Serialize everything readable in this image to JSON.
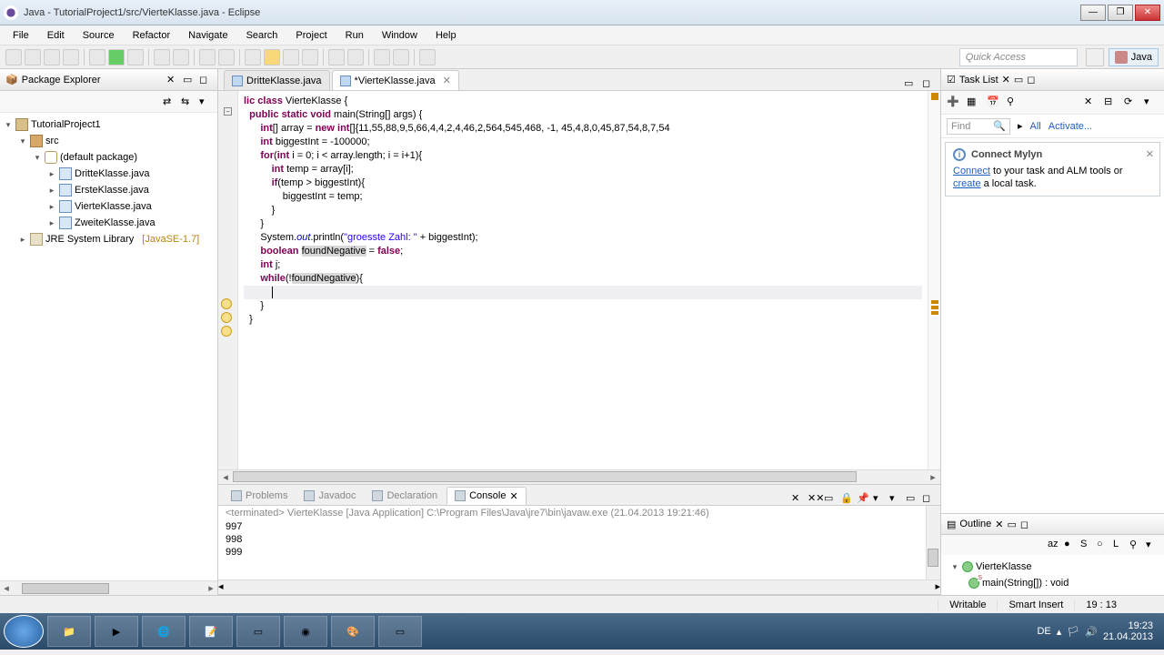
{
  "window": {
    "title": "Java - TutorialProject1/src/VierteKlasse.java - Eclipse"
  },
  "menu": [
    "File",
    "Edit",
    "Source",
    "Refactor",
    "Navigate",
    "Search",
    "Project",
    "Run",
    "Window",
    "Help"
  ],
  "quick_access": "Quick Access",
  "perspective": "Java",
  "package_explorer": {
    "title": "Package Explorer",
    "project": "TutorialProject1",
    "src": "src",
    "pkg": "(default package)",
    "files": [
      "DritteKlasse.java",
      "ErsteKlasse.java",
      "VierteKlasse.java",
      "ZweiteKlasse.java"
    ],
    "jre": "JRE System Library",
    "jre_suffix": "[JavaSE-1.7]"
  },
  "editor": {
    "tabs": [
      {
        "label": "DritteKlasse.java"
      },
      {
        "label": "*VierteKlasse.java"
      }
    ],
    "code": {
      "l1a": "lic class",
      "l1b": " VierteKlasse {",
      "l2a": "public static void",
      "l2b": " main(String[] args) {",
      "l3a": "int",
      "l3b": "[] array = ",
      "l3c": "new int",
      "l3d": "[]{11,55,88,9,5,66,4,4,2,4,46,2,564,545,468, -1, 45,4,8,0,45,87,54,8,7,54",
      "l4a": "int",
      "l4b": " biggestInt = -100000;",
      "l5a": "for",
      "l5b": "(",
      "l5c": "int",
      "l5d": " i = 0; i < array.length; i = i+1){",
      "l6a": "int",
      "l6b": " temp = array[i];",
      "l7": "",
      "l8a": "if",
      "l8b": "(temp > biggestInt){",
      "l9": "biggestInt = temp;",
      "l10": "}",
      "l11": "}",
      "l12": "",
      "l13a": "System.",
      "l13b": "out",
      "l13c": ".println(",
      "l13d": "\"groesste Zahl: \"",
      "l13e": " + biggestInt);",
      "l14": "",
      "l15a": "boolean",
      "l15b": " ",
      "l15c": "foundNegative",
      "l15d": " = ",
      "l15e": "false",
      "l15f": ";",
      "l16a": "int",
      "l16b": " j;",
      "l17a": "while",
      "l17b": "(!",
      "l17c": "foundNegative",
      "l17d": "){",
      "l18": "",
      "l19": "}",
      "l20": "",
      "l21": "}"
    }
  },
  "bottom_tabs": [
    "Problems",
    "Javadoc",
    "Declaration",
    "Console"
  ],
  "console": {
    "header": "<terminated> VierteKlasse [Java Application] C:\\Program Files\\Java\\jre7\\bin\\javaw.exe (21.04.2013 19:21:46)",
    "lines": [
      "997",
      "998",
      "999"
    ]
  },
  "task_list": {
    "title": "Task List",
    "find": "Find",
    "all": "All",
    "activate": "Activate..."
  },
  "mylyn": {
    "title": "Connect Mylyn",
    "connect": "Connect",
    "text1": " to your task and ALM tools or ",
    "create": "create",
    "text2": " a local task."
  },
  "outline": {
    "title": "Outline",
    "class": "VierteKlasse",
    "method": "main(String[]) : void"
  },
  "status": {
    "writable": "Writable",
    "insert": "Smart Insert",
    "pos": "19 : 13"
  },
  "tray": {
    "lang": "DE",
    "time": "19:23",
    "date": "21.04.2013"
  }
}
